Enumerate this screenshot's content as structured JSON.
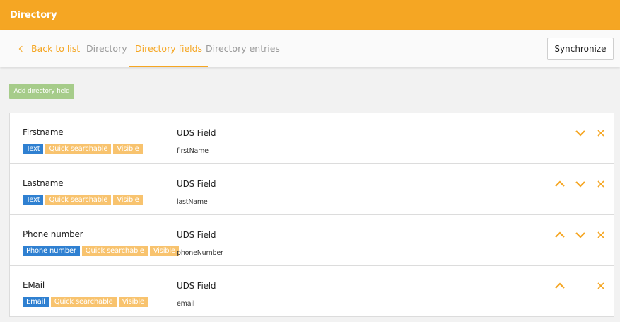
{
  "header": {
    "title": "Directory"
  },
  "nav": {
    "back": "Back to list",
    "tabs": [
      {
        "label": "Directory",
        "active": false
      },
      {
        "label": "Directory fields",
        "active": true
      },
      {
        "label": "Directory entries",
        "active": false
      }
    ],
    "synchronize": "Synchronize"
  },
  "toolbar": {
    "add_field": "Add directory field"
  },
  "colors": {
    "brand": "#f5a623",
    "type_tag": "#2f80d1",
    "flag_tag": "#f8c36e",
    "add_button": "#a6cc8a"
  },
  "fields": [
    {
      "name": "Firstname",
      "type": "Text",
      "flags": [
        "Quick searchable",
        "Visible"
      ],
      "uds_label": "UDS Field",
      "uds_value": "firstName",
      "can_move_up": false,
      "can_move_down": true
    },
    {
      "name": "Lastname",
      "type": "Text",
      "flags": [
        "Quick searchable",
        "Visible"
      ],
      "uds_label": "UDS Field",
      "uds_value": "lastName",
      "can_move_up": true,
      "can_move_down": true
    },
    {
      "name": "Phone number",
      "type": "Phone number",
      "flags": [
        "Quick searchable",
        "Visible"
      ],
      "uds_label": "UDS Field",
      "uds_value": "phoneNumber",
      "can_move_up": true,
      "can_move_down": true
    },
    {
      "name": "EMail",
      "type": "Email",
      "flags": [
        "Quick searchable",
        "Visible"
      ],
      "uds_label": "UDS Field",
      "uds_value": "email",
      "can_move_up": true,
      "can_move_down": false
    }
  ]
}
